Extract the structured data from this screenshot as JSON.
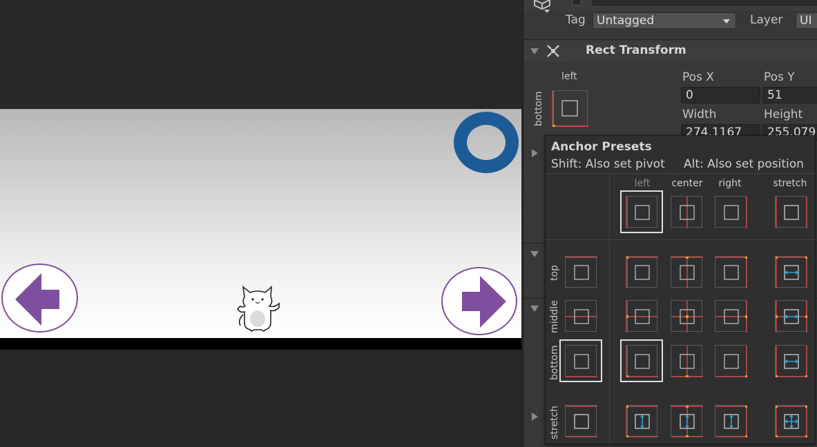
{
  "inspector": {
    "tag_label": "Tag",
    "tag_value": "Untagged",
    "layer_label": "Layer",
    "layer_value": "UI",
    "component_title": "Rect Transform",
    "anchor_preview": {
      "horizontal": "left",
      "vertical": "bottom"
    },
    "pos_x_label": "Pos X",
    "pos_x_value": "0",
    "pos_y_label": "Pos Y",
    "pos_y_value": "51",
    "width_label": "Width",
    "width_value": "274.1167",
    "height_label": "Height",
    "height_value": "255.079"
  },
  "anchor_presets": {
    "title": "Anchor Presets",
    "hint_shift": "Shift: Also set pivot",
    "hint_alt": "Alt: Also set position",
    "columns": [
      "left",
      "center",
      "right",
      "stretch"
    ],
    "rows": [
      "top",
      "middle",
      "bottom",
      "stretch"
    ],
    "selected": {
      "column": "left",
      "row": "bottom"
    }
  },
  "game": {
    "left_button_icon": "arrow-left-icon",
    "right_button_icon": "arrow-right-icon",
    "character": "cat-character",
    "colors": {
      "ring": "#1c5b96",
      "arrow": "#7d4f9e",
      "ground": "#000000"
    }
  },
  "colors": {
    "anchor_red": "#c94848",
    "anchor_handle": "#e0a020",
    "anchor_blue": "#2aa1d8"
  }
}
